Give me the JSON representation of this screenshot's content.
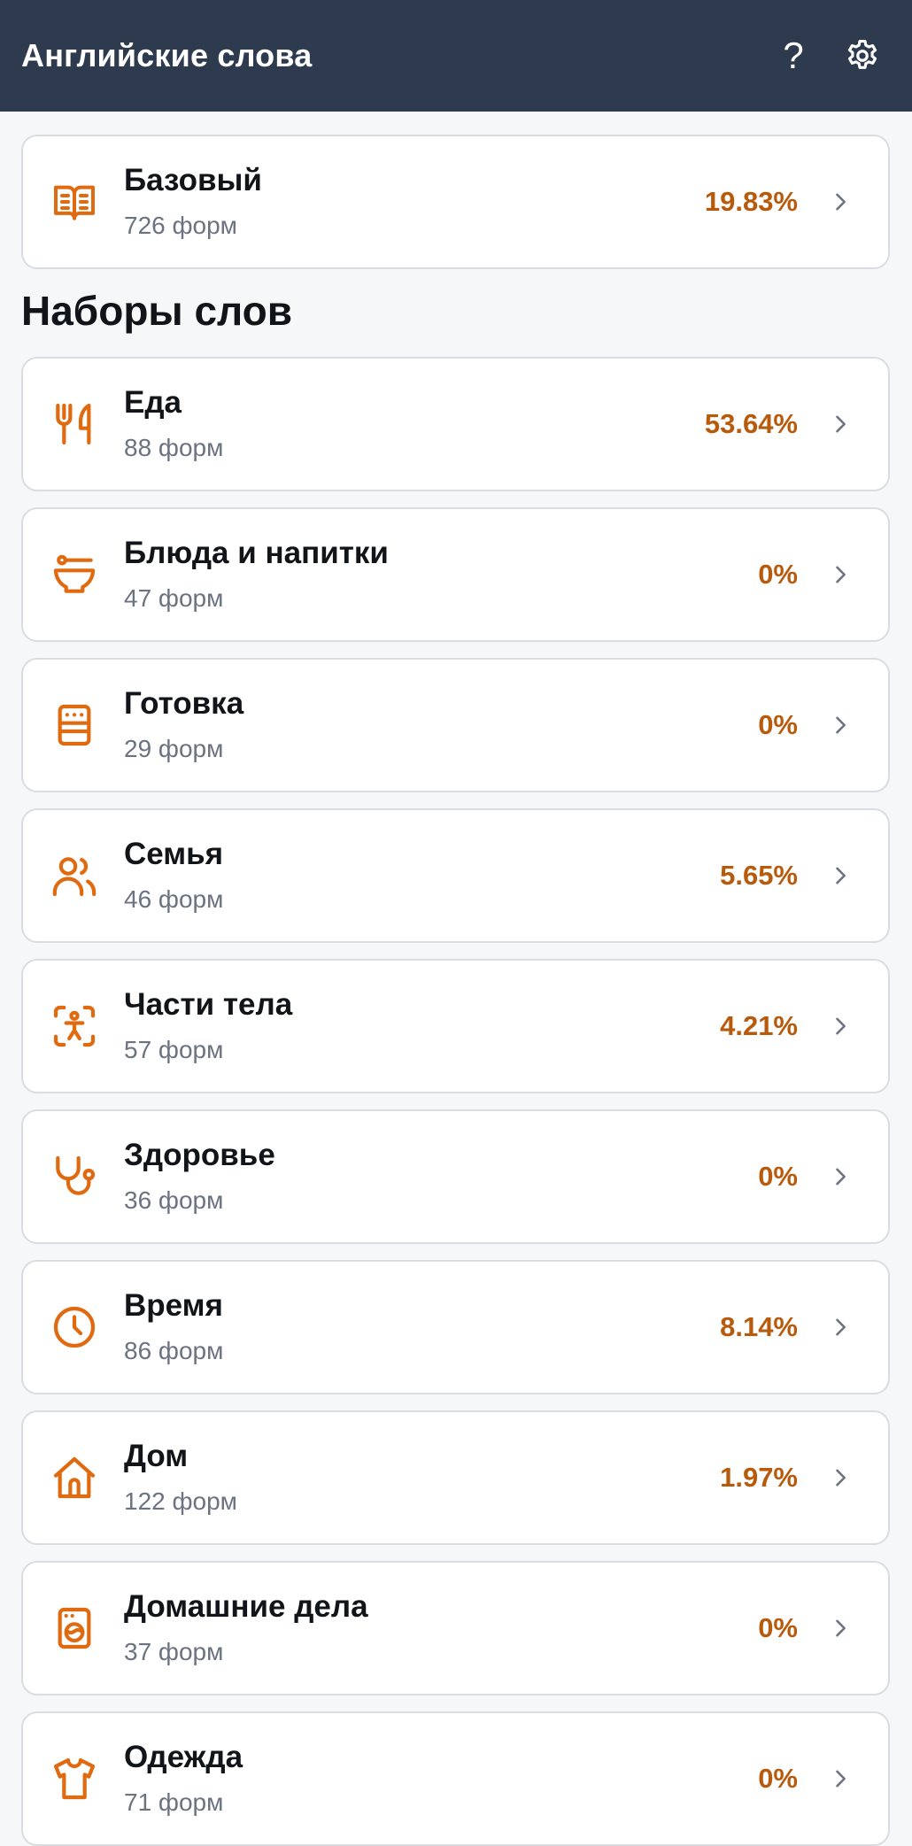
{
  "appbar": {
    "title": "Английские слова",
    "help_icon": "question-mark-icon",
    "settings_icon": "gear-icon",
    "help_label": "?"
  },
  "colors": {
    "appbar_bg": "#2e3a4e",
    "accent_icon": "#e06a10",
    "percent": "#b85a0c",
    "subtext": "#6b7280"
  },
  "base_deck": {
    "title": "Базовый",
    "subtitle": "726 форм",
    "percent": "19.83%",
    "icon": "book-icon"
  },
  "section_title": "Наборы слов",
  "decks": [
    {
      "title": "Еда",
      "subtitle": "88 форм",
      "percent": "53.64%",
      "icon": "fork-knife-icon"
    },
    {
      "title": "Блюда и напитки",
      "subtitle": "47 форм",
      "percent": "0%",
      "icon": "bowl-icon"
    },
    {
      "title": "Готовка",
      "subtitle": "29 форм",
      "percent": "0%",
      "icon": "stove-icon"
    },
    {
      "title": "Семья",
      "subtitle": "46 форм",
      "percent": "5.65%",
      "icon": "users-icon"
    },
    {
      "title": "Части тела",
      "subtitle": "57 форм",
      "percent": "4.21%",
      "icon": "body-scan-icon"
    },
    {
      "title": "Здоровье",
      "subtitle": "36 форм",
      "percent": "0%",
      "icon": "stethoscope-icon"
    },
    {
      "title": "Время",
      "subtitle": "86 форм",
      "percent": "8.14%",
      "icon": "clock-icon"
    },
    {
      "title": "Дом",
      "subtitle": "122 форм",
      "percent": "1.97%",
      "icon": "home-icon"
    },
    {
      "title": "Домашние дела",
      "subtitle": "37 форм",
      "percent": "0%",
      "icon": "washing-machine-icon"
    },
    {
      "title": "Одежда",
      "subtitle": "71 форм",
      "percent": "0%",
      "icon": "shirt-icon"
    }
  ]
}
